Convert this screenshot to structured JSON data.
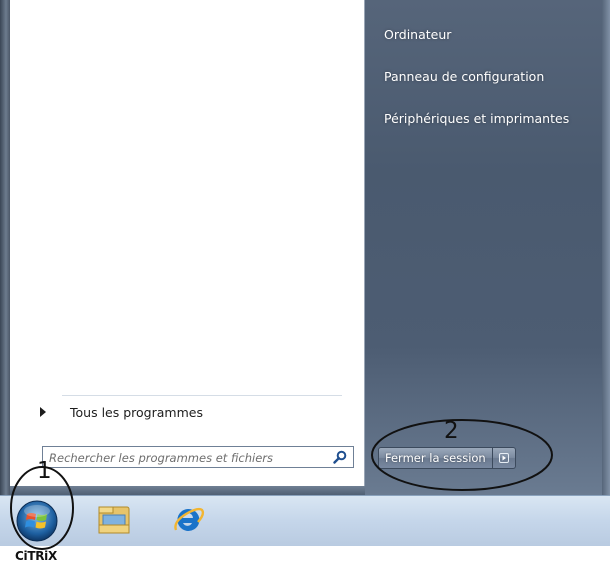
{
  "right_pane": {
    "items": [
      {
        "label": "Ordinateur"
      },
      {
        "label": "Panneau de configuration"
      },
      {
        "label": "Périphériques et imprimantes"
      }
    ]
  },
  "left_pane": {
    "all_programs_label": "Tous les programmes",
    "search_placeholder": "Rechercher les programmes et fichiers"
  },
  "session": {
    "logoff_label": "Fermer la session"
  },
  "taskbar": {
    "icons": [
      "windows-start-orb-icon",
      "windows-explorer-icon",
      "internet-explorer-icon"
    ]
  },
  "branding": {
    "citrix_label": "CiTRiX"
  },
  "annotations": {
    "label_1": "1",
    "label_2": "2"
  },
  "colors": {
    "right_pane": "#4d5d73",
    "taskbar": "#c5d6ea",
    "annotation_ink": "#111111"
  }
}
